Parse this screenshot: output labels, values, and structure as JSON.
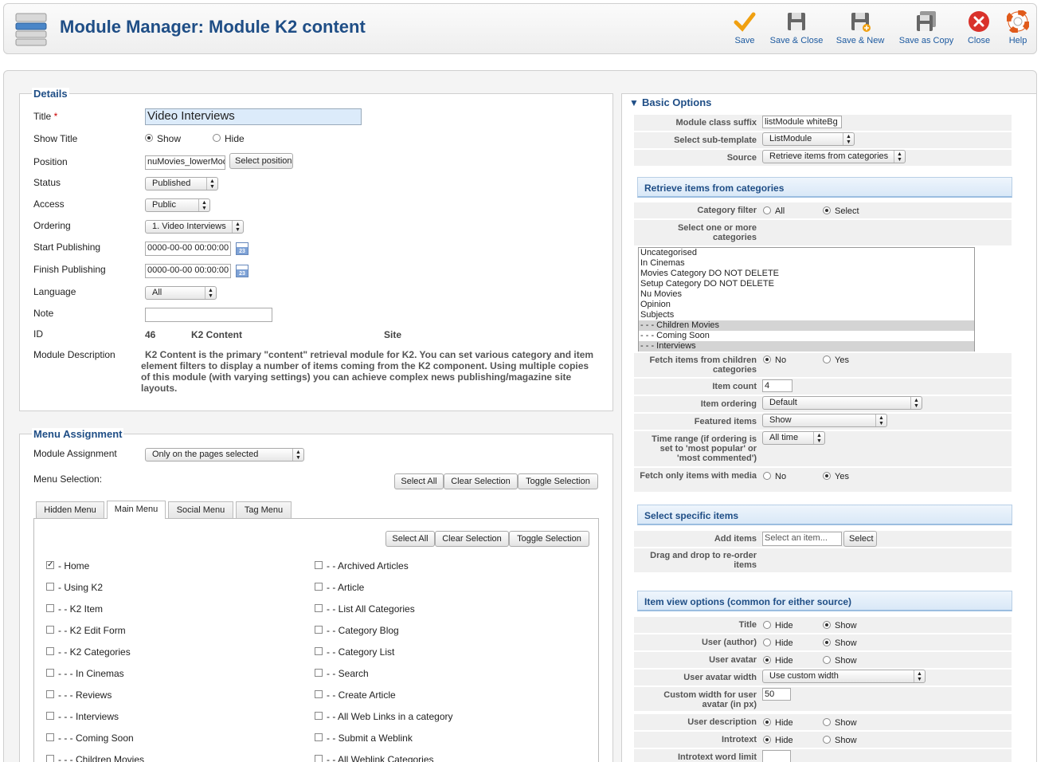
{
  "header": {
    "title": "Module Manager: Module K2 content",
    "toolbar": [
      {
        "label": "Save",
        "icon": "checkmark-icon"
      },
      {
        "label": "Save & Close",
        "icon": "floppy-disk-icon"
      },
      {
        "label": "Save & New",
        "icon": "floppy-disk-plus-icon"
      },
      {
        "label": "Save as Copy",
        "icon": "floppy-disk-copy-icon"
      },
      {
        "label": "Close",
        "icon": "close-circle-icon"
      },
      {
        "label": "Help",
        "icon": "lifebuoy-icon"
      }
    ]
  },
  "details": {
    "legend": "Details",
    "title_label": "Title",
    "required_mark": "*",
    "title_value": "Video Interviews",
    "show_title_label": "Show Title",
    "show_title_options": [
      "Show",
      "Hide"
    ],
    "show_title_selected": "Show",
    "position_label": "Position",
    "position_value": "nuMovies_lowerModule",
    "select_position_button": "Select position",
    "status_label": "Status",
    "status_value": "Published",
    "access_label": "Access",
    "access_value": "Public",
    "ordering_label": "Ordering",
    "ordering_value": "1. Video Interviews",
    "start_publishing_label": "Start Publishing",
    "start_publishing_value": "0000-00-00 00:00:00",
    "finish_publishing_label": "Finish Publishing",
    "finish_publishing_value": "0000-00-00 00:00:00",
    "calendar_icon_text": "23",
    "language_label": "Language",
    "language_value": "All",
    "note_label": "Note",
    "note_value": "",
    "id_label": "ID",
    "id_value": "46",
    "module_type": "K2 Content",
    "client": "Site",
    "description_label": "Module Description",
    "description": "K2 Content is the primary \"content\" retrieval module for K2. You can set various category and item element filters to display a number of items coming from the K2 component. Using multiple copies of this module (with varying settings) you can achieve complex news publishing/magazine site layouts."
  },
  "menu_assignment": {
    "legend": "Menu Assignment",
    "module_assignment_label": "Module Assignment",
    "module_assignment_value": "Only on the pages selected",
    "menu_selection_label": "Menu Selection:",
    "buttons": [
      "Select All",
      "Clear Selection",
      "Toggle Selection"
    ],
    "tabs": [
      "Hidden Menu",
      "Main Menu",
      "Social Menu",
      "Tag Menu"
    ],
    "active_tab": "Main Menu",
    "items_left": [
      {
        "label": "- Home",
        "checked": true
      },
      {
        "label": "- Using K2",
        "checked": false
      },
      {
        "label": "- - K2 Item",
        "checked": false
      },
      {
        "label": "- - K2 Edit Form",
        "checked": false
      },
      {
        "label": "- - K2 Categories",
        "checked": false
      },
      {
        "label": "- - - In Cinemas",
        "checked": false
      },
      {
        "label": "- - - Reviews",
        "checked": false
      },
      {
        "label": "- - - Interviews",
        "checked": false
      },
      {
        "label": "- - - Coming Soon",
        "checked": false
      },
      {
        "label": "- - - Children Movies",
        "checked": false
      }
    ],
    "items_right": [
      {
        "label": "- - Archived Articles",
        "checked": false
      },
      {
        "label": "- - Article",
        "checked": false
      },
      {
        "label": "- - List All Categories",
        "checked": false
      },
      {
        "label": "- - Category Blog",
        "checked": false
      },
      {
        "label": "- - Category List",
        "checked": false
      },
      {
        "label": "- - Search",
        "checked": false
      },
      {
        "label": "- - Create Article",
        "checked": false
      },
      {
        "label": "- - All Web Links in a category",
        "checked": false
      },
      {
        "label": "- - Submit a Weblink",
        "checked": false
      },
      {
        "label": "- - All Weblink Categories",
        "checked": false
      }
    ]
  },
  "basic_options": {
    "legend": "Basic Options",
    "class_suffix_label": "Module class suffix",
    "class_suffix_value": "listModule whiteBg",
    "subtemplate_label": "Select sub-template",
    "subtemplate_value": "ListModule",
    "source_label": "Source",
    "source_value": "Retrieve items from categories",
    "retrieve_head": "Retrieve items from categories",
    "category_filter_label": "Category filter",
    "category_filter_options": [
      "All",
      "Select"
    ],
    "category_filter_selected": "Select",
    "select_categories_label": "Select one or more categories",
    "categories": [
      {
        "label": "Uncategorised",
        "selected": false
      },
      {
        "label": "In Cinemas",
        "selected": false
      },
      {
        "label": "Movies Category DO NOT DELETE",
        "selected": false
      },
      {
        "label": "Setup Category DO NOT DELETE",
        "selected": false
      },
      {
        "label": "Nu Movies",
        "selected": false
      },
      {
        "label": "Opinion",
        "selected": false
      },
      {
        "label": "Subjects",
        "selected": false
      },
      {
        "label": "- - - Children Movies",
        "selected": true
      },
      {
        "label": "- - - Coming Soon",
        "selected": false
      },
      {
        "label": "- - - Interviews",
        "selected": true
      }
    ],
    "fetch_children_label": "Fetch items from children categories",
    "no_label": "No",
    "yes_label": "Yes",
    "item_count_label": "Item count",
    "item_count_value": "4",
    "item_ordering_label": "Item ordering",
    "item_ordering_value": "Default",
    "featured_label": "Featured items",
    "featured_value": "Show",
    "time_range_label": "Time range (if ordering is set to 'most popular' or 'most commented')",
    "time_range_value": "All time",
    "fetch_media_label": "Fetch only items with media",
    "specific_head": "Select specific items",
    "add_items_label": "Add items",
    "add_items_placeholder": "Select an item...",
    "add_items_button": "Select",
    "drag_label": "Drag and drop to re-order items",
    "itemview_head": "Item view options (common for either source)",
    "hide_label": "Hide",
    "show_label": "Show",
    "iv_title_label": "Title",
    "iv_user_label": "User (author)",
    "iv_avatar_label": "User avatar",
    "iv_avatar_width_label": "User avatar width",
    "iv_avatar_width_value": "Use custom width",
    "iv_custom_width_label": "Custom width for user avatar (in px)",
    "iv_custom_width_value": "50",
    "iv_user_desc_label": "User description",
    "iv_introtext_label": "Introtext",
    "iv_word_limit_label": "Introtext word limit",
    "iv_word_limit_value": ""
  }
}
